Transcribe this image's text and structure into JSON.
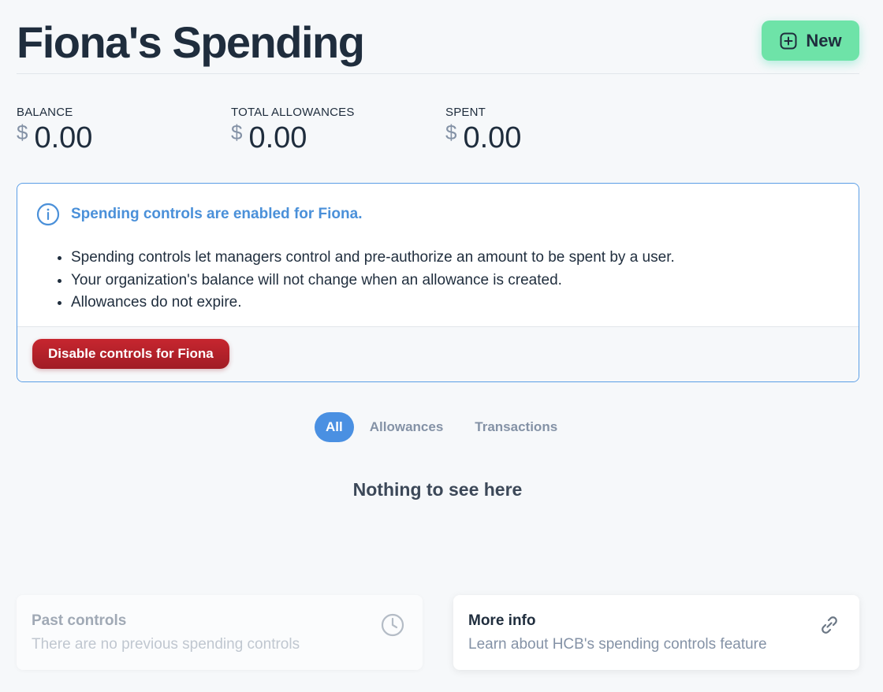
{
  "header": {
    "title": "Fiona's Spending",
    "new_button_label": "New"
  },
  "stats": [
    {
      "label": "BALANCE",
      "currency": "$",
      "value": "0.00"
    },
    {
      "label": "TOTAL ALLOWANCES",
      "currency": "$",
      "value": "0.00"
    },
    {
      "label": "SPENT",
      "currency": "$",
      "value": "0.00"
    }
  ],
  "callout": {
    "title": "Spending controls are enabled for Fiona.",
    "items": [
      "Spending controls let managers control and pre-authorize an amount to be spent by a user.",
      "Your organization's balance will not change when an allowance is created.",
      "Allowances do not expire."
    ],
    "disable_button_label": "Disable controls for Fiona"
  },
  "tabs": [
    {
      "label": "All",
      "active": true
    },
    {
      "label": "Allowances",
      "active": false
    },
    {
      "label": "Transactions",
      "active": false
    }
  ],
  "empty_state": "Nothing to see here",
  "cards": {
    "past": {
      "title": "Past controls",
      "subtitle": "There are no previous spending controls",
      "icon": "clock-icon"
    },
    "more": {
      "title": "More info",
      "subtitle": "Learn about HCB's spending controls feature",
      "icon": "link-icon"
    }
  },
  "colors": {
    "accent_blue": "#4a90e2",
    "new_button_green": "#6ee3a8",
    "danger_red": "#c7262f"
  }
}
